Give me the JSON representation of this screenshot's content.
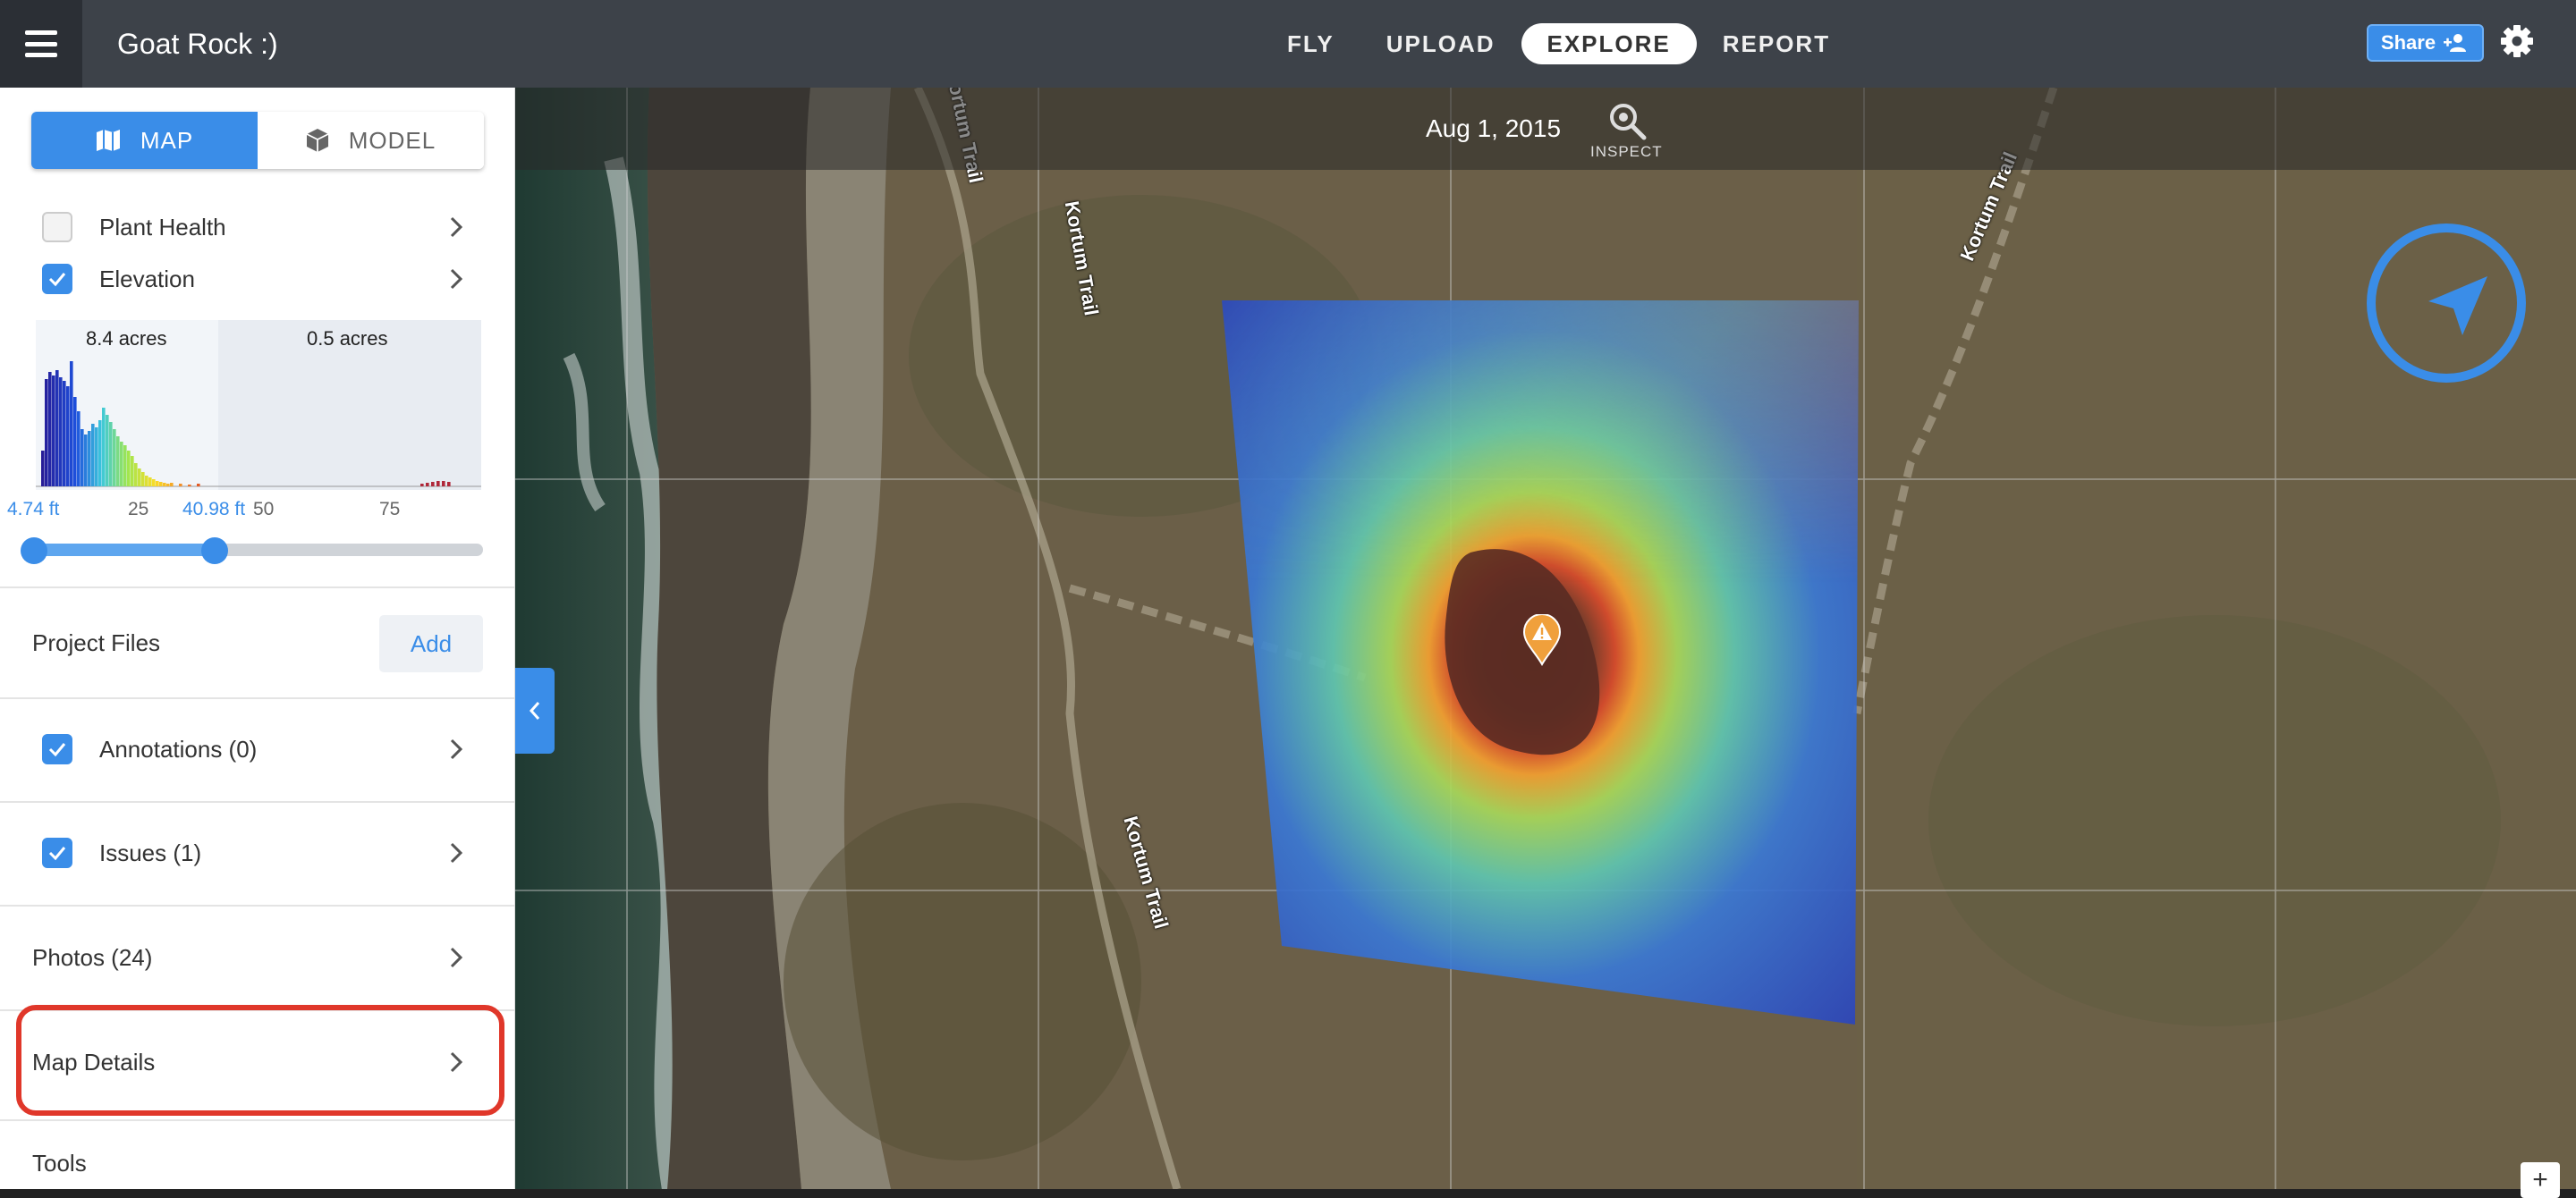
{
  "header": {
    "project_title": "Goat Rock :)",
    "nav_tabs": [
      {
        "label": "FLY",
        "active": false
      },
      {
        "label": "UPLOAD",
        "active": false
      },
      {
        "label": "EXPLORE",
        "active": true
      },
      {
        "label": "REPORT",
        "active": false
      }
    ],
    "share_label": "Share",
    "icons": {
      "menu": "hamburger-icon",
      "share": "add-user-icon",
      "settings": "gear-icon"
    }
  },
  "sidebar": {
    "view_toggle": {
      "map_label": "MAP",
      "model_label": "MODEL",
      "selected": "MAP"
    },
    "layers": [
      {
        "label": "Plant Health",
        "checked": false
      },
      {
        "label": "Elevation",
        "checked": true
      }
    ],
    "elevation": {
      "selected_area": "8.4 acres",
      "unselected_area": "0.5 acres",
      "range_min_label": "4.74 ft",
      "range_max_label": "40.98 ft",
      "axis_ticks": [
        "25",
        "50",
        "75"
      ],
      "range_min_value": 4.74,
      "range_max_value": 40.98
    },
    "project_files": {
      "label": "Project Files",
      "add_label": "Add"
    },
    "annotations": {
      "label": "Annotations (0)",
      "checked": true
    },
    "issues": {
      "label": "Issues (1)",
      "checked": true
    },
    "photos": {
      "label": "Photos (24)"
    },
    "map_details": {
      "label": "Map Details",
      "highlighted": true
    },
    "tools": {
      "label": "Tools"
    }
  },
  "map": {
    "date": "Aug 1, 2015",
    "inspect_label": "INSPECT",
    "trail_labels": [
      "Kortum Trail",
      "Kortum Trail",
      "Kortum Trail",
      "Kortum Trail"
    ],
    "zoom_in_label": "+",
    "colors": {
      "accent": "#3a8de8",
      "highlight": "#e0372a",
      "issue_pin": "#f0a03c"
    }
  }
}
